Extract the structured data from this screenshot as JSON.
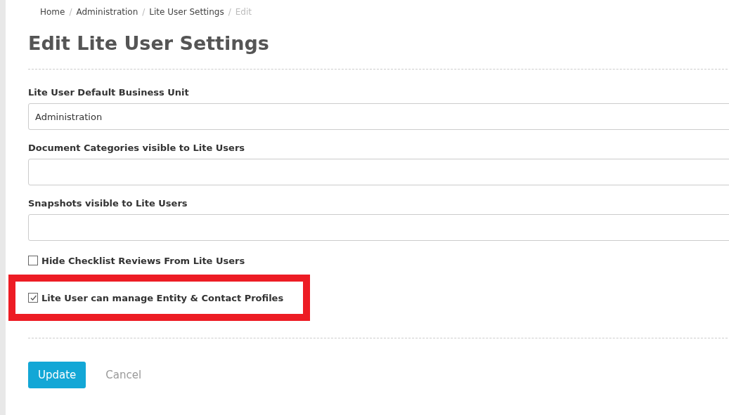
{
  "breadcrumb": [
    {
      "label": "Home",
      "current": false,
      "separator": "/"
    },
    {
      "label": "Administration",
      "current": false,
      "separator": "/"
    },
    {
      "label": "Lite User Settings",
      "current": false,
      "separator": "/"
    },
    {
      "label": "Edit",
      "current": true
    }
  ],
  "title": "Edit Lite User Settings",
  "fields": [
    {
      "label": "Lite User Default Business Unit",
      "value": "Administration"
    },
    {
      "label": "Document Categories visible to Lite Users"
    },
    {
      "label": "Snapshots visible to Lite Users"
    }
  ],
  "checkboxes": [
    {
      "label": "Hide Checklist Reviews From Lite Users",
      "checked": false,
      "highlighted": false
    },
    {
      "label": "Lite User can manage Entity & Contact Profiles",
      "checked": true,
      "highlighted": true
    }
  ],
  "buttons": [
    {
      "label": "Update",
      "kind": "primary"
    },
    {
      "label": "Cancel",
      "kind": "link"
    }
  ]
}
